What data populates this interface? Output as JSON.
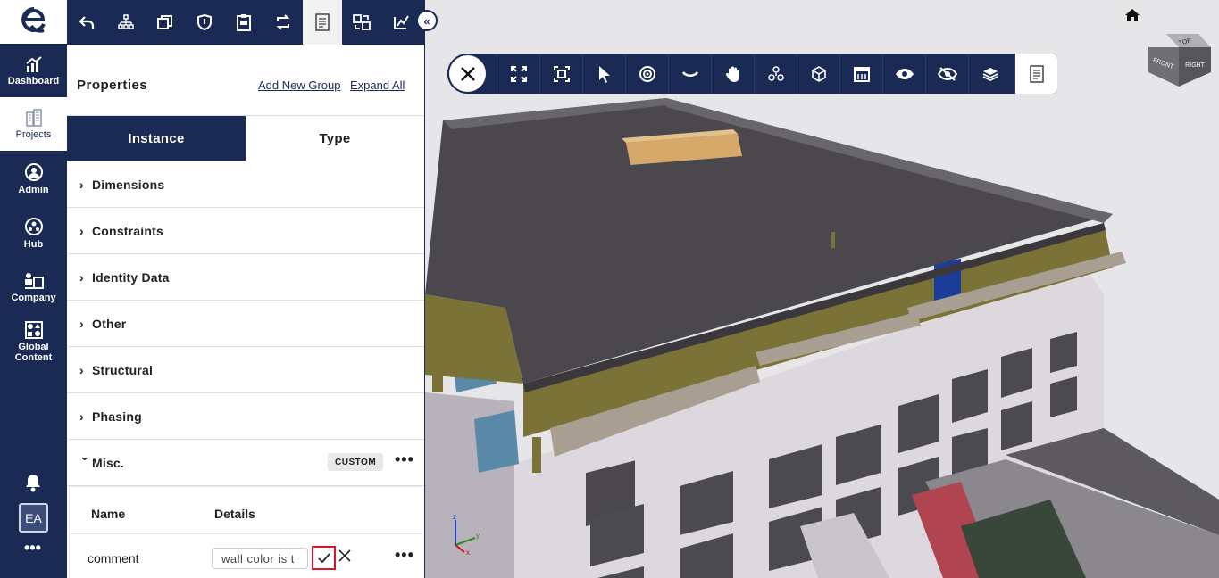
{
  "nav": {
    "items": [
      {
        "label": "Dashboard",
        "icon": "chart-icon"
      },
      {
        "label": "Projects",
        "icon": "building-icon"
      },
      {
        "label": "Admin",
        "icon": "admin-icon"
      },
      {
        "label": "Hub",
        "icon": "hub-icon"
      },
      {
        "label": "Company",
        "icon": "company-icon"
      },
      {
        "label": "Global Content",
        "icon": "shapes-icon"
      }
    ],
    "avatar": "EA",
    "more": "•••"
  },
  "panel": {
    "title": "Properties",
    "add_group": "Add New Group",
    "expand_all": "Expand All",
    "tabs": [
      "Instance",
      "Type"
    ],
    "groups": [
      "Dimensions",
      "Constraints",
      "Identity Data",
      "Other",
      "Structural",
      "Phasing",
      "Misc."
    ],
    "misc_badge": "CUSTOM",
    "more": "•••",
    "table": {
      "headers": [
        "Name",
        "Details"
      ],
      "row": {
        "name": "comment",
        "value": "wall color is t"
      }
    }
  },
  "viewer": {
    "cube_labels": [
      "TOP",
      "FRONT",
      "RIGHT"
    ],
    "axes": [
      "z",
      "y",
      "x"
    ]
  },
  "colors": {
    "navy": "#1b2a55",
    "highlight": "#e0102a",
    "roof": "#4a484c",
    "walls": "#d9d5da",
    "band": "#7a7236"
  }
}
